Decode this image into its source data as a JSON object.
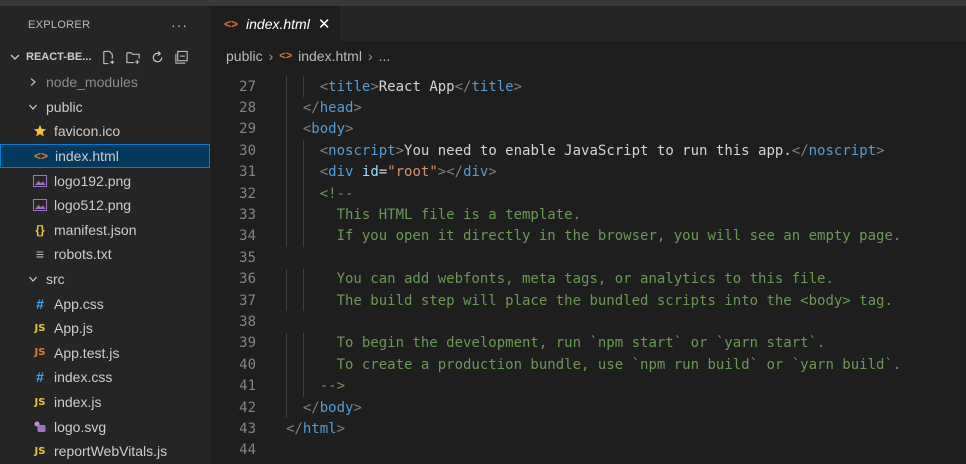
{
  "sidebar": {
    "title": "EXPLORER",
    "more_label": "···",
    "project": "REACT-BE...",
    "items": [
      {
        "label": "node_modules",
        "type": "folder",
        "expanded": false,
        "level": 0,
        "icon": "chevron-right-icon",
        "dim": true
      },
      {
        "label": "public",
        "type": "folder",
        "expanded": true,
        "level": 0,
        "icon": "chevron-down-icon"
      },
      {
        "label": "favicon.ico",
        "type": "file",
        "level": 1,
        "icon": "star-icon"
      },
      {
        "label": "index.html",
        "type": "file",
        "level": 1,
        "icon": "html-icon",
        "selected": true
      },
      {
        "label": "logo192.png",
        "type": "file",
        "level": 1,
        "icon": "image-icon"
      },
      {
        "label": "logo512.png",
        "type": "file",
        "level": 1,
        "icon": "image-icon"
      },
      {
        "label": "manifest.json",
        "type": "file",
        "level": 1,
        "icon": "json-icon"
      },
      {
        "label": "robots.txt",
        "type": "file",
        "level": 1,
        "icon": "text-file-icon"
      },
      {
        "label": "src",
        "type": "folder",
        "expanded": true,
        "level": 0,
        "icon": "chevron-down-icon"
      },
      {
        "label": "App.css",
        "type": "file",
        "level": 1,
        "icon": "css-icon"
      },
      {
        "label": "App.js",
        "type": "file",
        "level": 1,
        "icon": "js-icon"
      },
      {
        "label": "App.test.js",
        "type": "file",
        "level": 1,
        "icon": "js-test-icon"
      },
      {
        "label": "index.css",
        "type": "file",
        "level": 1,
        "icon": "css-icon"
      },
      {
        "label": "index.js",
        "type": "file",
        "level": 1,
        "icon": "js-icon"
      },
      {
        "label": "logo.svg",
        "type": "file",
        "level": 1,
        "icon": "svg-icon"
      },
      {
        "label": "reportWebVitals.js",
        "type": "file",
        "level": 1,
        "icon": "js-icon"
      }
    ]
  },
  "editor": {
    "tab": {
      "label": "index.html",
      "close_label": "✕"
    },
    "breadcrumb": {
      "folder": "public",
      "file": "index.html",
      "more": "..."
    },
    "lines": [
      {
        "n": "27",
        "indent": 2,
        "tokens": [
          [
            "p",
            "<"
          ],
          [
            "tg",
            "title"
          ],
          [
            "p",
            ">"
          ],
          [
            "tx",
            "React App"
          ],
          [
            "p",
            "</"
          ],
          [
            "tg",
            "title"
          ],
          [
            "p",
            ">"
          ]
        ]
      },
      {
        "n": "28",
        "indent": 1,
        "tokens": [
          [
            "p",
            "</"
          ],
          [
            "tg",
            "head"
          ],
          [
            "p",
            ">"
          ]
        ]
      },
      {
        "n": "29",
        "indent": 1,
        "tokens": [
          [
            "p",
            "<"
          ],
          [
            "tg",
            "body"
          ],
          [
            "p",
            ">"
          ]
        ]
      },
      {
        "n": "30",
        "indent": 2,
        "tokens": [
          [
            "p",
            "<"
          ],
          [
            "tg",
            "noscript"
          ],
          [
            "p",
            ">"
          ],
          [
            "tx",
            "You need to enable JavaScript to run this app."
          ],
          [
            "p",
            "</"
          ],
          [
            "tg",
            "noscript"
          ],
          [
            "p",
            ">"
          ]
        ]
      },
      {
        "n": "31",
        "indent": 2,
        "tokens": [
          [
            "p",
            "<"
          ],
          [
            "tg",
            "div"
          ],
          [
            "tx",
            " "
          ],
          [
            "at",
            "id"
          ],
          [
            "tx",
            "="
          ],
          [
            "sv",
            "\"root\""
          ],
          [
            "p",
            "></"
          ],
          [
            "tg",
            "div"
          ],
          [
            "p",
            ">"
          ]
        ]
      },
      {
        "n": "32",
        "indent": 2,
        "tokens": [
          [
            "cm",
            "<!--"
          ]
        ]
      },
      {
        "n": "33",
        "indent": 2,
        "tokens": [
          [
            "cm",
            "  This HTML file is a template."
          ]
        ]
      },
      {
        "n": "34",
        "indent": 2,
        "tokens": [
          [
            "cm",
            "  If you open it directly in the browser, you will see an empty page."
          ]
        ]
      },
      {
        "n": "35",
        "indent": 0,
        "tokens": []
      },
      {
        "n": "36",
        "indent": 2,
        "tokens": [
          [
            "cm",
            "  You can add webfonts, meta tags, or analytics to this file."
          ]
        ]
      },
      {
        "n": "37",
        "indent": 2,
        "tokens": [
          [
            "cm",
            "  The build step will place the bundled scripts into the <body> tag."
          ]
        ]
      },
      {
        "n": "38",
        "indent": 0,
        "tokens": []
      },
      {
        "n": "39",
        "indent": 2,
        "tokens": [
          [
            "cm",
            "  To begin the development, run `npm start` or `yarn start`."
          ]
        ]
      },
      {
        "n": "40",
        "indent": 2,
        "tokens": [
          [
            "cm",
            "  To create a production bundle, use `npm run build` or `yarn build`."
          ]
        ]
      },
      {
        "n": "41",
        "indent": 2,
        "tokens": [
          [
            "cm",
            "-->"
          ]
        ]
      },
      {
        "n": "42",
        "indent": 1,
        "tokens": [
          [
            "p",
            "</"
          ],
          [
            "tg",
            "body"
          ],
          [
            "p",
            ">"
          ]
        ]
      },
      {
        "n": "43",
        "indent": 0,
        "tokens": [
          [
            "p",
            "</"
          ],
          [
            "tg",
            "html"
          ],
          [
            "p",
            ">"
          ]
        ]
      },
      {
        "n": "44",
        "indent": 0,
        "tokens": []
      }
    ]
  }
}
